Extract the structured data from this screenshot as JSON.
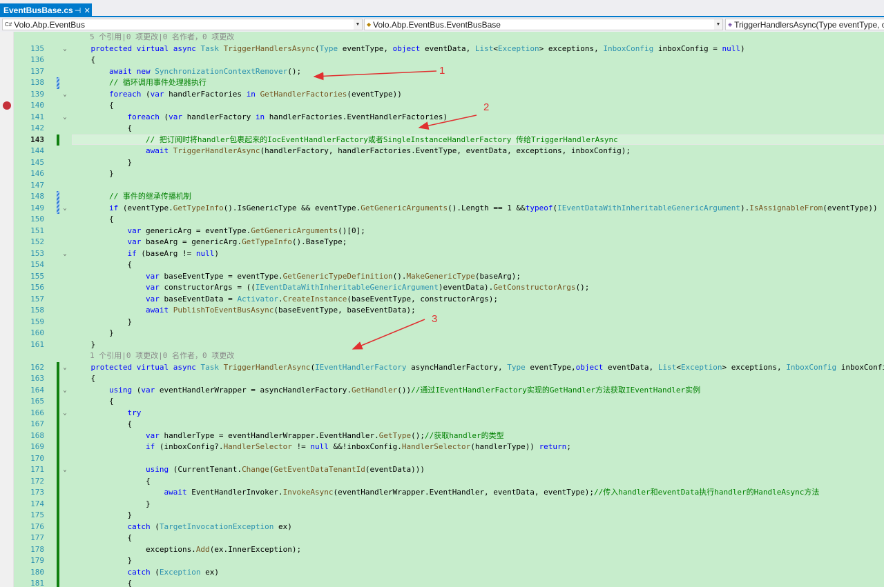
{
  "tab": {
    "title": "EventBusBase.cs",
    "pin_icon": "pin-icon",
    "close_icon": "close-icon"
  },
  "nav": {
    "project": "Volo.Abp.EventBus",
    "type": "Volo.Abp.EventBus.EventBusBase",
    "member": "TriggerHandlersAsync(Type eventType, ob"
  },
  "breakpoint_line": "140",
  "current_line": "143",
  "annotations": [
    "1",
    "2",
    "3"
  ],
  "codelens": [
    "5 个引用|0 项更改|0 名作者，0 项更改",
    "1 个引用|0 项更改|0 名作者，0 项更改"
  ],
  "code_lines": [
    {
      "n": "135",
      "t": "    protected virtual async Task TriggerHandlersAsync(Type eventType, object eventData, List<Exception> exceptions, InboxConfig inboxConfig = null)"
    },
    {
      "n": "136",
      "t": "    {"
    },
    {
      "n": "137",
      "t": "        await new SynchronizationContextRemover();"
    },
    {
      "n": "138",
      "t": "        // 循环调用事件处理器执行"
    },
    {
      "n": "139",
      "t": "        foreach (var handlerFactories in GetHandlerFactories(eventType))"
    },
    {
      "n": "140",
      "t": "        {"
    },
    {
      "n": "141",
      "t": "            foreach (var handlerFactory in handlerFactories.EventHandlerFactories)"
    },
    {
      "n": "142",
      "t": "            {"
    },
    {
      "n": "143",
      "t": "                // 把订阅时将handler包裹起来的IocEventHandlerFactory或者SingleInstanceHandlerFactory 传给TriggerHandlerAsync"
    },
    {
      "n": "144",
      "t": "                await TriggerHandlerAsync(handlerFactory, handlerFactories.EventType, eventData, exceptions, inboxConfig);"
    },
    {
      "n": "145",
      "t": "            }"
    },
    {
      "n": "146",
      "t": "        }"
    },
    {
      "n": "147",
      "t": ""
    },
    {
      "n": "148",
      "t": "        // 事件的继承传播机制"
    },
    {
      "n": "149",
      "t": "        if (eventType.GetTypeInfo().IsGenericType && eventType.GetGenericArguments().Length == 1 &&typeof(IEventDataWithInheritableGenericArgument).IsAssignableFrom(eventType))"
    },
    {
      "n": "150",
      "t": "        {"
    },
    {
      "n": "151",
      "t": "            var genericArg = eventType.GetGenericArguments()[0];"
    },
    {
      "n": "152",
      "t": "            var baseArg = genericArg.GetTypeInfo().BaseType;"
    },
    {
      "n": "153",
      "t": "            if (baseArg != null)"
    },
    {
      "n": "154",
      "t": "            {"
    },
    {
      "n": "155",
      "t": "                var baseEventType = eventType.GetGenericTypeDefinition().MakeGenericType(baseArg);"
    },
    {
      "n": "156",
      "t": "                var constructorArgs = ((IEventDataWithInheritableGenericArgument)eventData).GetConstructorArgs();"
    },
    {
      "n": "157",
      "t": "                var baseEventData = Activator.CreateInstance(baseEventType, constructorArgs);"
    },
    {
      "n": "158",
      "t": "                await PublishToEventBusAsync(baseEventType, baseEventData);"
    },
    {
      "n": "159",
      "t": "            }"
    },
    {
      "n": "160",
      "t": "        }"
    },
    {
      "n": "161",
      "t": "    }"
    },
    {
      "n": "162",
      "t": "    protected virtual async Task TriggerHandlerAsync(IEventHandlerFactory asyncHandlerFactory, Type eventType,object eventData, List<Exception> exceptions, InboxConfig inboxConfig = null)"
    },
    {
      "n": "163",
      "t": "    {"
    },
    {
      "n": "164",
      "t": "        using (var eventHandlerWrapper = asyncHandlerFactory.GetHandler())//通过IEventHandlerFactory实现的GetHandler方法获取IEventHandler实例"
    },
    {
      "n": "165",
      "t": "        {"
    },
    {
      "n": "166",
      "t": "            try"
    },
    {
      "n": "167",
      "t": "            {"
    },
    {
      "n": "168",
      "t": "                var handlerType = eventHandlerWrapper.EventHandler.GetType();//获取handler的类型"
    },
    {
      "n": "169",
      "t": "                if (inboxConfig?.HandlerSelector != null &&!inboxConfig.HandlerSelector(handlerType)) return;"
    },
    {
      "n": "170",
      "t": ""
    },
    {
      "n": "171",
      "t": "                using (CurrentTenant.Change(GetEventDataTenantId(eventData)))"
    },
    {
      "n": "172",
      "t": "                {"
    },
    {
      "n": "173",
      "t": "                    await EventHandlerInvoker.InvokeAsync(eventHandlerWrapper.EventHandler, eventData, eventType);//传入handler和eventData执行handler的HandleAsync方法"
    },
    {
      "n": "174",
      "t": "                }"
    },
    {
      "n": "175",
      "t": "            }"
    },
    {
      "n": "176",
      "t": "            catch (TargetInvocationException ex)"
    },
    {
      "n": "177",
      "t": "            {"
    },
    {
      "n": "178",
      "t": "                exceptions.Add(ex.InnerException);"
    },
    {
      "n": "179",
      "t": "            }"
    },
    {
      "n": "180",
      "t": "            catch (Exception ex)"
    },
    {
      "n": "181",
      "t": "            {"
    }
  ]
}
